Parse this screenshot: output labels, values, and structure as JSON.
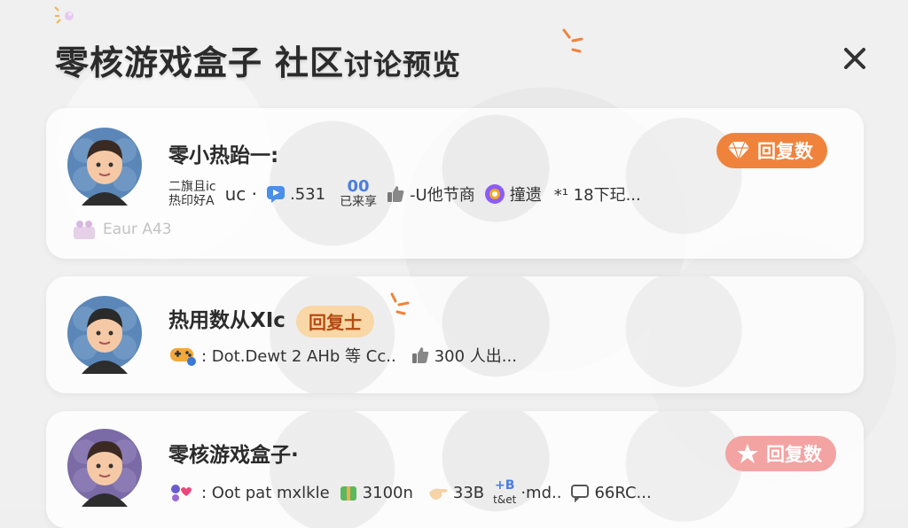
{
  "header": {
    "title_main": "零核游戏盒子",
    "title_sub": "社区",
    "title_tail": "讨论预览"
  },
  "posts": [
    {
      "title": "零小热跆一:",
      "faded_text": "Eaur A43",
      "badge_label": "回复数",
      "meta": {
        "stack_line1": "二旗且ic",
        "stack_line2": "热印好A",
        "uc": "uc ·",
        "comment_count": ".531",
        "share_num": "00",
        "share_label": "已来享",
        "like_label": "-U他节商",
        "tag_label": "撞遗",
        "time_text": "*¹ 18下玘..."
      }
    },
    {
      "title": "热用数从XIc",
      "badge_label": "回复士",
      "meta": {
        "author": ": Dot.Dewt 2 AHb 等 Cc..",
        "like_count": "300 人出..."
      }
    },
    {
      "title": "零核游戏盒子·",
      "badge_label": "回复数",
      "meta": {
        "author": ": Oot pat mxlkle",
        "views": "3100n",
        "likes": "33B",
        "hash_top": "+B",
        "hash_bottom": "t&et",
        "hash_text": "·md..",
        "comments": "66RC..."
      }
    }
  ],
  "colors": {
    "badge_orange": "#f0833b",
    "badge_pink": "#f4a3a3",
    "inline_badge_bg": "#f9d7a6",
    "accent_blue": "#4a7de0"
  }
}
